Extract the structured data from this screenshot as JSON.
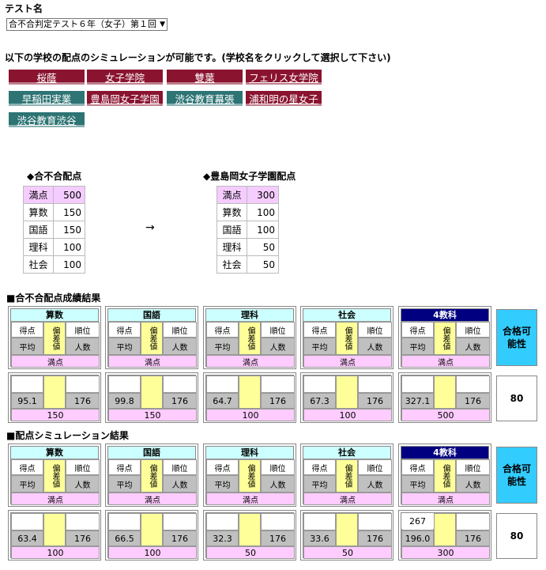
{
  "header": {
    "test_name_label": "テスト名",
    "test_select_value": "合不合判定テスト６年（女子）第１回"
  },
  "instruction": "以下の学校の配点のシミュレーションが可能です。(学校名をクリックして選択して下さい)",
  "schools": [
    {
      "label": "桜蔭",
      "color": "#8a1430"
    },
    {
      "label": "女子学院",
      "color": "#8a1430"
    },
    {
      "label": "雙葉",
      "color": "#8a1430"
    },
    {
      "label": "フェリス女学院",
      "color": "#8a1430"
    },
    {
      "label": "早稲田実業",
      "color": "#2e7474"
    },
    {
      "label": "豊島岡女子学園",
      "color": "#8a1430"
    },
    {
      "label": "渋谷教育幕張",
      "color": "#2e7474"
    },
    {
      "label": "浦和明の星女子",
      "color": "#8a1430"
    },
    {
      "label": "渋谷教育渋谷",
      "color": "#2e7474"
    }
  ],
  "points_left": {
    "title": "◆合不合配点",
    "rows": [
      {
        "k": "満点",
        "v": "500"
      },
      {
        "k": "算数",
        "v": "150"
      },
      {
        "k": "国語",
        "v": "150"
      },
      {
        "k": "理科",
        "v": "100"
      },
      {
        "k": "社会",
        "v": "100"
      }
    ]
  },
  "arrow": "→",
  "points_right": {
    "title": "◆豊島岡女子学園配点",
    "rows": [
      {
        "k": "満点",
        "v": "300"
      },
      {
        "k": "算数",
        "v": "100"
      },
      {
        "k": "国語",
        "v": "100"
      },
      {
        "k": "理科",
        "v": "50"
      },
      {
        "k": "社会",
        "v": "50"
      }
    ]
  },
  "labels": {
    "score": "得点",
    "hensa": "偏差値",
    "rank": "順位",
    "avg": "平均",
    "count": "人数",
    "full": "満点",
    "goukaku": "合格可能性"
  },
  "section1": {
    "title": "■合不合配点成績結果",
    "subjects": [
      {
        "name": "算数",
        "avg": "95.1",
        "count": "176",
        "full": "150"
      },
      {
        "name": "国語",
        "avg": "99.8",
        "count": "176",
        "full": "150"
      },
      {
        "name": "理科",
        "avg": "64.7",
        "count": "176",
        "full": "100"
      },
      {
        "name": "社会",
        "avg": "67.3",
        "count": "176",
        "full": "100"
      },
      {
        "name": "4教科",
        "avg": "327.1",
        "count": "176",
        "full": "500"
      }
    ],
    "goukaku_value": "80"
  },
  "section2": {
    "title": "■配点シミュレーション結果",
    "subjects": [
      {
        "name": "算数",
        "avg": "63.4",
        "count": "176",
        "full": "100"
      },
      {
        "name": "国語",
        "avg": "66.5",
        "count": "176",
        "full": "100"
      },
      {
        "name": "理科",
        "avg": "32.3",
        "count": "176",
        "full": "50"
      },
      {
        "name": "社会",
        "avg": "33.6",
        "count": "176",
        "full": "50"
      },
      {
        "name": "4教科",
        "score": "267",
        "avg": "196.0",
        "count": "176",
        "full": "300"
      }
    ],
    "goukaku_value": "80"
  }
}
